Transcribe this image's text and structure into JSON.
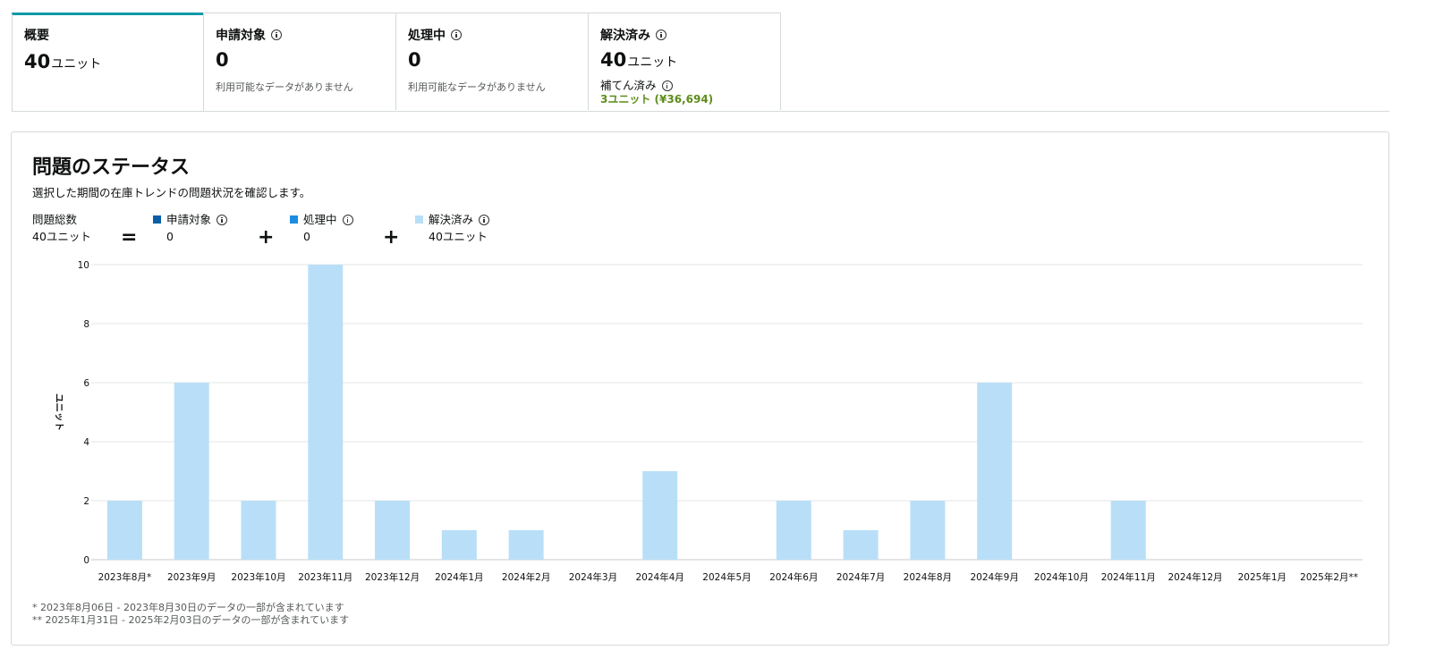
{
  "tabs": [
    {
      "label": "概要",
      "value": "40",
      "unit": "ユニット",
      "note": "",
      "has_info": false
    },
    {
      "label": "申請対象",
      "value": "0",
      "unit": "",
      "note": "利用可能なデータがありません",
      "has_info": true
    },
    {
      "label": "処理中",
      "value": "0",
      "unit": "",
      "note": "利用可能なデータがありません",
      "has_info": true
    },
    {
      "label": "解決済み",
      "value": "40",
      "unit": "ユニット",
      "note": "",
      "has_info": true,
      "sub_label": "補てん済み",
      "sub_value": "3ユニット (¥36,694)"
    }
  ],
  "panel": {
    "title": "問題のステータス",
    "description": "選択した期間の在庫トレンドの問題状況を確認します。",
    "summary": {
      "total_label": "問題総数",
      "total_value": "40ユニット",
      "equals": "=",
      "plus": "+",
      "items": [
        {
          "label": "申請対象",
          "value": "0",
          "color": "#0a5ea8"
        },
        {
          "label": "処理中",
          "value": "0",
          "color": "#1a8de0"
        },
        {
          "label": "解決済み",
          "value": "40ユニット",
          "color": "#b9dff8"
        }
      ]
    },
    "footnotes": [
      "*  2023年8月06日 - 2023年8月30日のデータの一部が含まれています",
      "** 2025年1月31日 - 2025年2月03日のデータの一部が含まれています"
    ]
  },
  "colors": {
    "accent": "#0d9aa6",
    "bar": "#b9dff8",
    "grid": "#e3e6e6",
    "reimbursed": "#5e8c1b"
  },
  "chart_data": {
    "type": "bar",
    "ylabel": "ユニット",
    "ylim": [
      0,
      10
    ],
    "yticks": [
      0,
      2,
      4,
      6,
      8,
      10
    ],
    "grid": true,
    "categories": [
      "2023年8月*",
      "2023年9月",
      "2023年10月",
      "2023年11月",
      "2023年12月",
      "2024年1月",
      "2024年2月",
      "2024年3月",
      "2024年4月",
      "2024年5月",
      "2024年6月",
      "2024年7月",
      "2024年8月",
      "2024年9月",
      "2024年10月",
      "2024年11月",
      "2024年12月",
      "2025年1月",
      "2025年2月**"
    ],
    "series": [
      {
        "name": "解決済み",
        "values": [
          2,
          6,
          2,
          10,
          2,
          1,
          1,
          0,
          3,
          0,
          2,
          1,
          2,
          6,
          0,
          2,
          0,
          0,
          0
        ]
      }
    ]
  }
}
